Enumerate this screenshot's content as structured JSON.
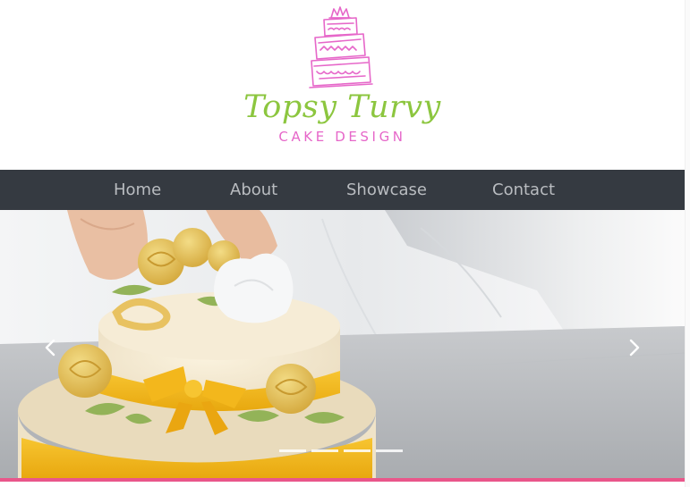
{
  "brand": {
    "name": "Topsy Turvy",
    "tagline": "CAKE DESIGN"
  },
  "nav": {
    "home": "Home",
    "about": "About",
    "showcase": "Showcase",
    "contact": "Contact"
  },
  "hero": {
    "slide_count": 4
  },
  "colors": {
    "brand_green": "#8cc63f",
    "brand_pink": "#e667c9",
    "nav_background": "#353a41",
    "accent_line": "#e9568a"
  },
  "icons": {
    "logo": "cake-logo-icon",
    "previous": "chevron-left-icon",
    "next": "chevron-right-icon"
  }
}
